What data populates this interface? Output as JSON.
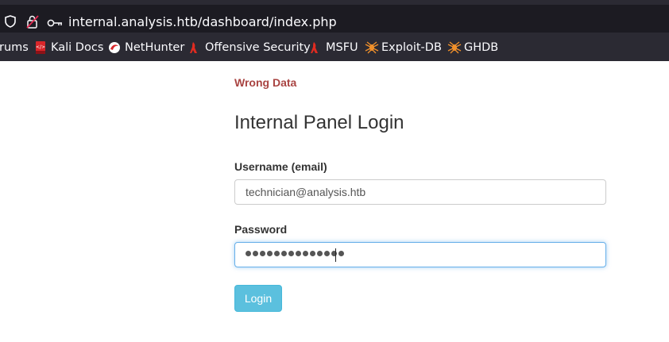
{
  "browser": {
    "url": "internal.analysis.htb/dashboard/index.php",
    "bookmarks": [
      {
        "label": "rums",
        "icon": "forum-icon"
      },
      {
        "label": "Kali Docs",
        "icon": "kali-docs-icon"
      },
      {
        "label": "NetHunter",
        "icon": "nethunter-icon"
      },
      {
        "label": "Offensive Security",
        "icon": "offsec-icon"
      },
      {
        "label": "MSFU",
        "icon": "msfu-icon"
      },
      {
        "label": "Exploit-DB",
        "icon": "exploit-db-icon"
      },
      {
        "label": "GHDB",
        "icon": "ghdb-icon"
      }
    ]
  },
  "page": {
    "error_message": "Wrong Data",
    "title": "Internal Panel Login",
    "username_label": "Username (email)",
    "username_value": "technician@analysis.htb",
    "password_label": "Password",
    "password_length": 14,
    "login_label": "Login"
  },
  "colors": {
    "error": "#a94442",
    "button": "#5bc0de",
    "focus": "#66afe9"
  }
}
